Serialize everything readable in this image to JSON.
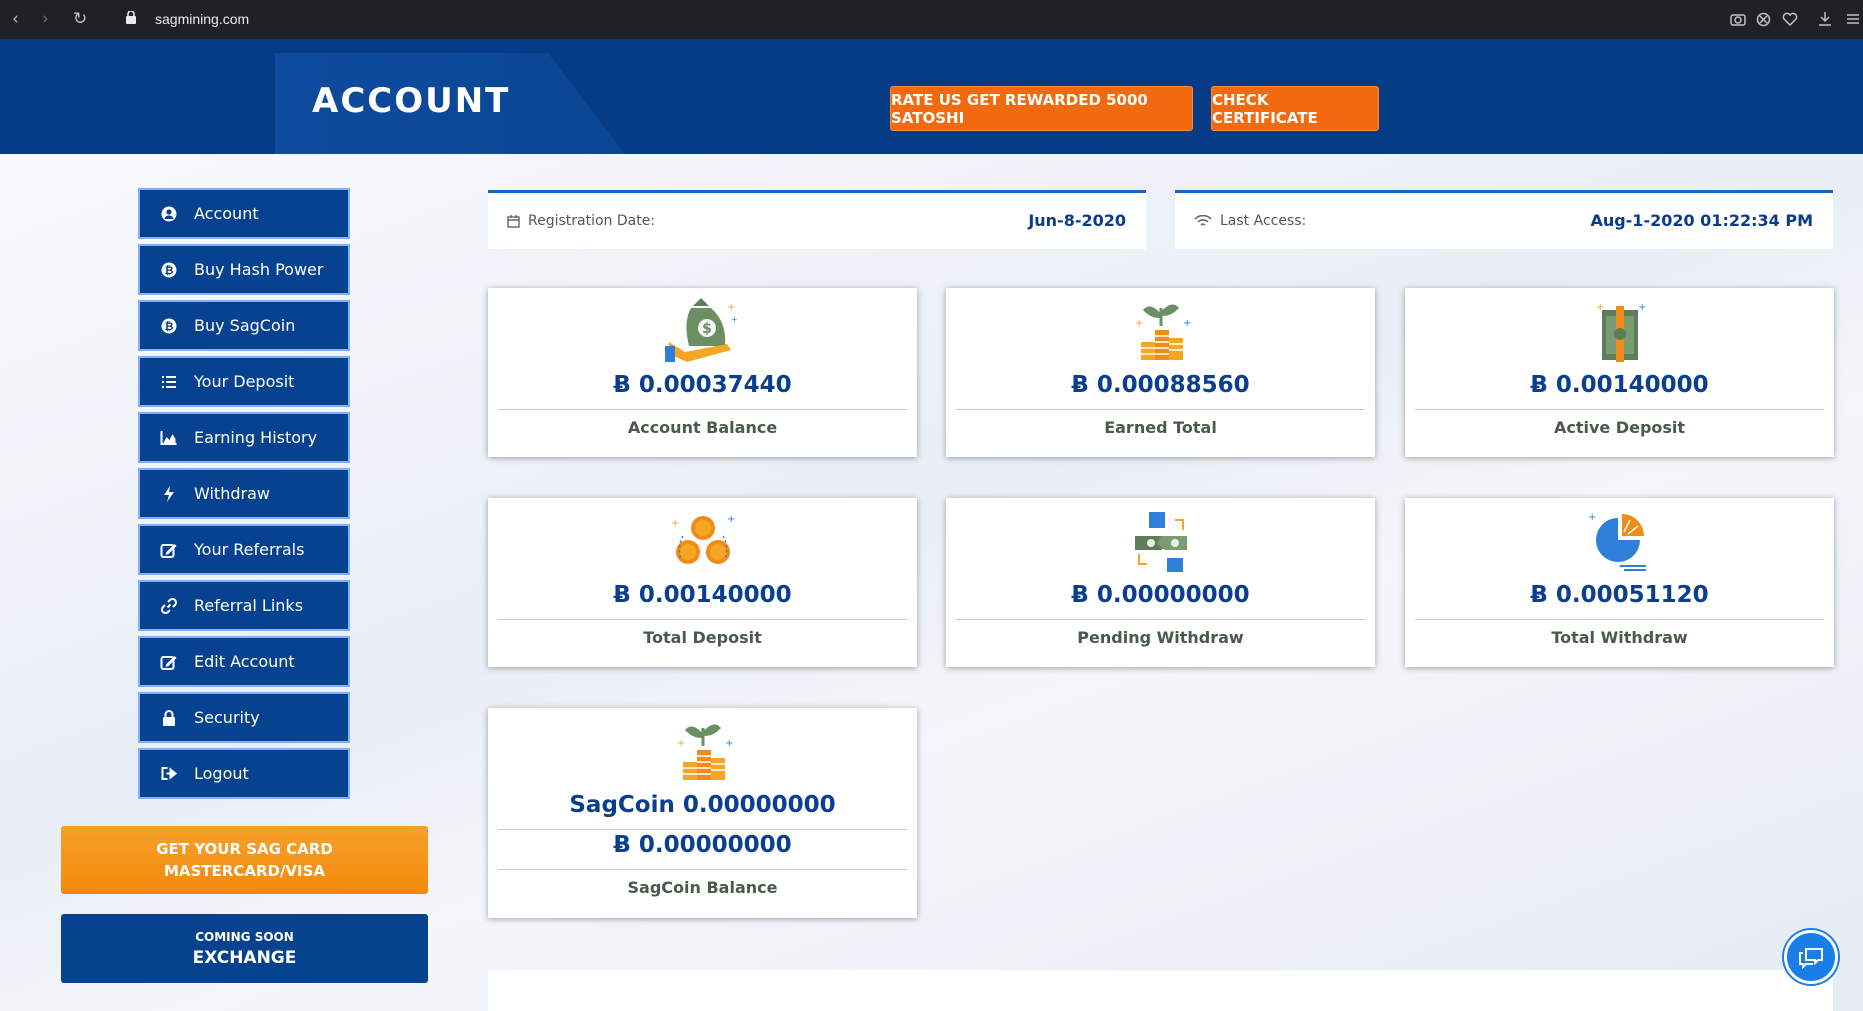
{
  "browser": {
    "url": "sagmining.com",
    "back_icon": "‹",
    "forward_icon": "›",
    "reload_icon": "↻"
  },
  "header": {
    "title": "ACCOUNT",
    "rate_button": "RATE US GET REWARDED 5000 SATOSHI",
    "certificate_button": "CHECK CERTIFICATE"
  },
  "sidebar": {
    "items": [
      {
        "label": "Account",
        "icon": "user-circle-icon"
      },
      {
        "label": "Buy Hash Power",
        "icon": "bitcoin-icon"
      },
      {
        "label": "Buy SagCoin",
        "icon": "bitcoin-icon"
      },
      {
        "label": "Your Deposit",
        "icon": "list-icon"
      },
      {
        "label": "Earning History",
        "icon": "area-chart-icon"
      },
      {
        "label": "Withdraw",
        "icon": "bolt-icon"
      },
      {
        "label": "Your Referrals",
        "icon": "edit-icon"
      },
      {
        "label": "Referral Links",
        "icon": "link-icon"
      },
      {
        "label": "Edit Account",
        "icon": "edit-icon"
      },
      {
        "label": "Security",
        "icon": "lock-icon"
      },
      {
        "label": "Logout",
        "icon": "sign-out-icon"
      }
    ]
  },
  "promo": {
    "card_line1": "GET YOUR SAG CARD",
    "card_line2": "MASTERCARD/VISA",
    "exchange_small": "COMING SOON",
    "exchange_big": "EXCHANGE"
  },
  "info": {
    "registration_label": "Registration Date:",
    "registration_value": "Jun-8-2020",
    "access_label": "Last Access:",
    "access_value": "Aug-1-2020 01:22:34 PM"
  },
  "cards": {
    "account_balance": {
      "amount": "Ƀ 0.00037440",
      "label": "Account Balance"
    },
    "earned_total": {
      "amount": "Ƀ 0.00088560",
      "label": "Earned Total"
    },
    "active_deposit": {
      "amount": "Ƀ 0.00140000",
      "label": "Active Deposit"
    },
    "total_deposit": {
      "amount": "Ƀ 0.00140000",
      "label": "Total Deposit"
    },
    "pending_withdraw": {
      "amount": "Ƀ 0.00000000",
      "label": "Pending Withdraw"
    },
    "total_withdraw": {
      "amount": "Ƀ 0.00051120",
      "label": "Total Withdraw"
    },
    "sagcoin_balance": {
      "amount_sag": "SagCoin 0.00000000",
      "amount_btc": "Ƀ 0.00000000",
      "label": "SagCoin Balance"
    }
  },
  "colors": {
    "header_blue": "#063c86",
    "menu_blue": "#064290",
    "accent_orange": "#f26a0f",
    "value_blue": "#0a3f8f"
  }
}
